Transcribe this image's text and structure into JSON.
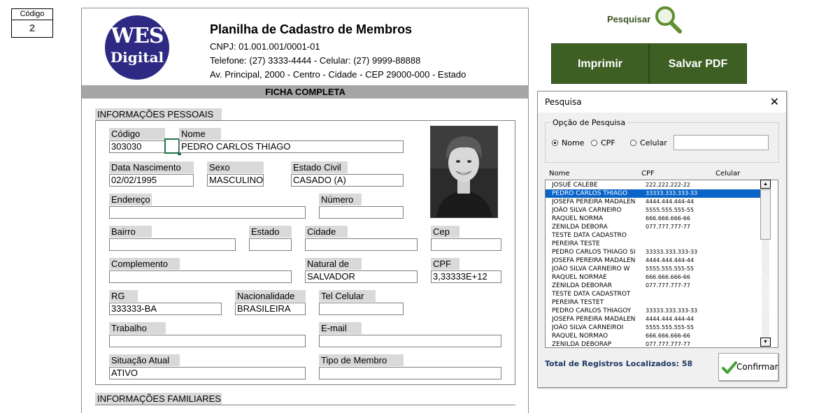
{
  "codigo": {
    "label": "Código",
    "value": "2"
  },
  "header": {
    "logo_line1": "WES",
    "logo_line2": "Digital",
    "title": "Planilha de Cadastro de Membros",
    "cnpj": "CNPJ: 01.001.001/0001-01",
    "phone": "Telefone: (27) 3333-4444  -  Celular: (27) 9999-88888",
    "address": "Av. Principal, 2000 - Centro - Cidade - CEP 29000-000 - Estado"
  },
  "band_title": "FICHA COMPLETA",
  "sections": {
    "personal": "INFORMAÇÕES PESSOAIS",
    "family": "INFORMAÇÕES FAMILIARES"
  },
  "fields": {
    "codigo": {
      "label": "Código",
      "value": "303030"
    },
    "nome": {
      "label": "Nome",
      "value": "PEDRO CARLOS THIAGO"
    },
    "data_nascimento": {
      "label": "Data Nascimento",
      "value": "02/02/1995"
    },
    "sexo": {
      "label": "Sexo",
      "value": "MASCULINO"
    },
    "estado_civil": {
      "label": "Estado Civil",
      "value": "CASADO (A)"
    },
    "endereco": {
      "label": "Endereço",
      "value": ""
    },
    "numero": {
      "label": "Número",
      "value": ""
    },
    "bairro": {
      "label": "Bairro",
      "value": ""
    },
    "estado": {
      "label": "Estado",
      "value": ""
    },
    "cidade": {
      "label": "Cidade",
      "value": ""
    },
    "cep": {
      "label": "Cep",
      "value": ""
    },
    "complemento": {
      "label": "Complemento",
      "value": ""
    },
    "natural_de": {
      "label": "Natural de",
      "value": "SALVADOR"
    },
    "cpf": {
      "label": "CPF",
      "value": "3,33333E+12"
    },
    "rg": {
      "label": "RG",
      "value": "333333-BA"
    },
    "nacionalidade": {
      "label": "Nacionalidade",
      "value": "BRASILEIRA"
    },
    "tel_celular": {
      "label": "Tel Celular",
      "value": ""
    },
    "trabalho": {
      "label": "Trabalho",
      "value": ""
    },
    "email": {
      "label": "E-mail",
      "value": ""
    },
    "situacao_atual": {
      "label": "Situação Atual",
      "value": "ATIVO"
    },
    "tipo_membro": {
      "label": "Tipo de Membro",
      "value": ""
    }
  },
  "toolbar": {
    "search_label": "Pesquisar",
    "print_label": "Imprimir",
    "pdf_label": "Salvar PDF"
  },
  "dialog": {
    "title": "Pesquisa",
    "group_label": "Opção de Pesquisa",
    "options": [
      "Nome",
      "CPF",
      "Celular"
    ],
    "selected_option": "Nome",
    "search_value": "",
    "columns": [
      "Nome",
      "CPF",
      "Celular"
    ],
    "rows": [
      {
        "nome": "JOSUÉ CALEBE",
        "cpf": "222.222.222-22",
        "celular": ""
      },
      {
        "nome": "PEDRO CARLOS THIAGO",
        "cpf": "33333.333.333-33",
        "celular": ""
      },
      {
        "nome": "JOSEFA PEREIRA MADALEN",
        "cpf": "4444.444.444-44",
        "celular": ""
      },
      {
        "nome": "JOÃO SILVA CARNEIRO",
        "cpf": "5555.555.555-55",
        "celular": ""
      },
      {
        "nome": "RAQUEL NORMA",
        "cpf": "666.666.666-66",
        "celular": ""
      },
      {
        "nome": "ZENILDA DEBORA",
        "cpf": "077.777.777-77",
        "celular": ""
      },
      {
        "nome": "TESTE DATA CADASTRO",
        "cpf": "",
        "celular": ""
      },
      {
        "nome": "PEREIRA TESTE",
        "cpf": "",
        "celular": ""
      },
      {
        "nome": "PEDRO CARLOS THIAGO SI",
        "cpf": "33333.333.333-33",
        "celular": ""
      },
      {
        "nome": "JOSEFA PEREIRA MADALEN",
        "cpf": "4444.444.444-44",
        "celular": ""
      },
      {
        "nome": "JOÃO SILVA CARNEIRO W",
        "cpf": "5555.555.555-55",
        "celular": ""
      },
      {
        "nome": "RAQUEL NORMAE",
        "cpf": "666.666.666-66",
        "celular": ""
      },
      {
        "nome": "ZENILDA DEBORAR",
        "cpf": "077.777.777-77",
        "celular": ""
      },
      {
        "nome": "TESTE DATA CADASTROT",
        "cpf": "",
        "celular": ""
      },
      {
        "nome": "PEREIRA TESTET",
        "cpf": "",
        "celular": ""
      },
      {
        "nome": "PEDRO CARLOS THIAGOY",
        "cpf": "33333.333.333-33",
        "celular": ""
      },
      {
        "nome": "JOSEFA PEREIRA MADALEN",
        "cpf": "4444.444.444-44",
        "celular": ""
      },
      {
        "nome": "JOÃO SILVA CARNEIROI",
        "cpf": "5555.555.555-55",
        "celular": ""
      },
      {
        "nome": "RAQUEL NORMAO",
        "cpf": "666.666.666-66",
        "celular": ""
      },
      {
        "nome": "ZENILDA DEBORAP",
        "cpf": "077.777.777-77",
        "celular": ""
      }
    ],
    "selected_row": 1,
    "total_text": "Total de Registros Localizados: 58",
    "confirm_label": "Confirmar"
  },
  "colors": {
    "brand": "#2e2a84",
    "button": "#3e5f24",
    "selection": "#0a64c8"
  }
}
